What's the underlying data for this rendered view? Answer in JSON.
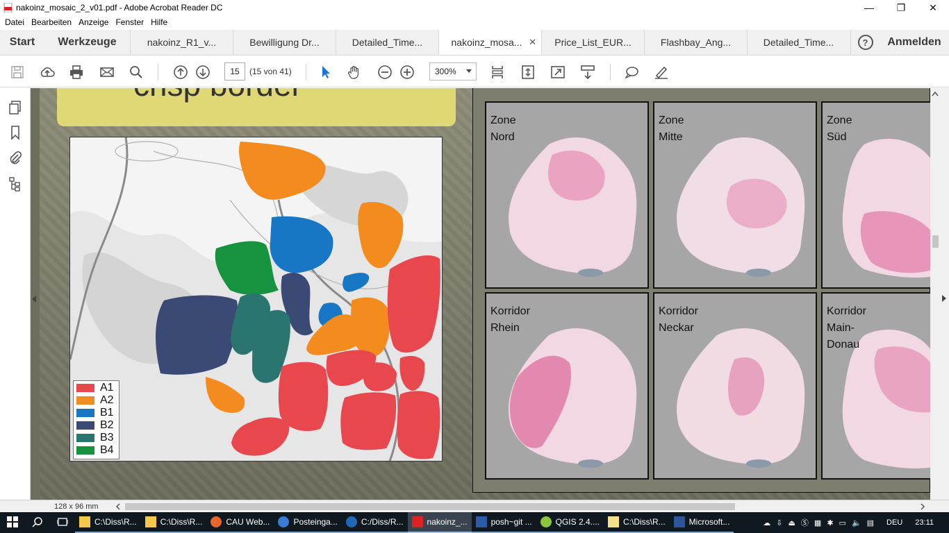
{
  "window": {
    "title": "nakoinz_mosaic_2_v01.pdf - Adobe Acrobat Reader DC",
    "controls": {
      "minimize": "—",
      "restore": "❐",
      "close": "✕"
    }
  },
  "menu": [
    "Datei",
    "Bearbeiten",
    "Anzeige",
    "Fenster",
    "Hilfe"
  ],
  "tabs": {
    "start": "Start",
    "tools": "Werkzeuge",
    "documents": [
      {
        "label": "nakoinz_R1_v...",
        "active": false
      },
      {
        "label": "Bewilligung Dr...",
        "active": false
      },
      {
        "label": "Detailed_Time...",
        "active": false
      },
      {
        "label": "nakoinz_mosa...",
        "active": true
      },
      {
        "label": "Price_List_EUR...",
        "active": false
      },
      {
        "label": "Flashbay_Ang...",
        "active": false
      },
      {
        "label": "Detailed_Time...",
        "active": false
      }
    ],
    "help": "?",
    "login": "Anmelden",
    "close_glyph": "✕"
  },
  "toolbar": {
    "page_number": "15",
    "page_count": "(15 von 41)",
    "zoom": "300%"
  },
  "slide": {
    "heading_fragment": "crisp border",
    "legend": [
      {
        "label": "A1",
        "color": "#e8474d"
      },
      {
        "label": "A2",
        "color": "#f48b1f"
      },
      {
        "label": "B1",
        "color": "#1877c4"
      },
      {
        "label": "B2",
        "color": "#3a4a74"
      },
      {
        "label": "B3",
        "color": "#2a7570"
      },
      {
        "label": "B4",
        "color": "#17923e"
      }
    ],
    "zone_maps": [
      {
        "label": "Zone\nNord"
      },
      {
        "label": "Zone\nMitte"
      },
      {
        "label": "Zone\nSüd"
      },
      {
        "label": "Korridor\nRhein"
      },
      {
        "label": "Korridor\nNeckar"
      },
      {
        "label": "Korridor\nMain-\nDonau"
      }
    ]
  },
  "status": {
    "page_size": "128 x 96 mm"
  },
  "taskbar": {
    "items": [
      {
        "label": "C:\\Diss\\R...",
        "icon": "folder-icon",
        "state": "running"
      },
      {
        "label": "C:\\Diss\\R...",
        "icon": "folder-icon",
        "state": "running"
      },
      {
        "label": "CAU Web...",
        "icon": "firefox-icon",
        "state": "running"
      },
      {
        "label": "Posteinga...",
        "icon": "thunderbird-icon",
        "state": "running"
      },
      {
        "label": "C:/Diss/R...",
        "icon": "r-icon",
        "state": "running"
      },
      {
        "label": "nakoinz_...",
        "icon": "acrobat-icon",
        "state": "active"
      },
      {
        "label": "posh~git ...",
        "icon": "powershell-icon",
        "state": "running"
      },
      {
        "label": "QGIS 2.4....",
        "icon": "qgis-icon",
        "state": "running"
      },
      {
        "label": "C:\\Diss\\R...",
        "icon": "notepad-icon",
        "state": "running"
      },
      {
        "label": "Microsoft...",
        "icon": "word-icon",
        "state": "running"
      }
    ],
    "language": "DEU",
    "clock": "23:11"
  }
}
